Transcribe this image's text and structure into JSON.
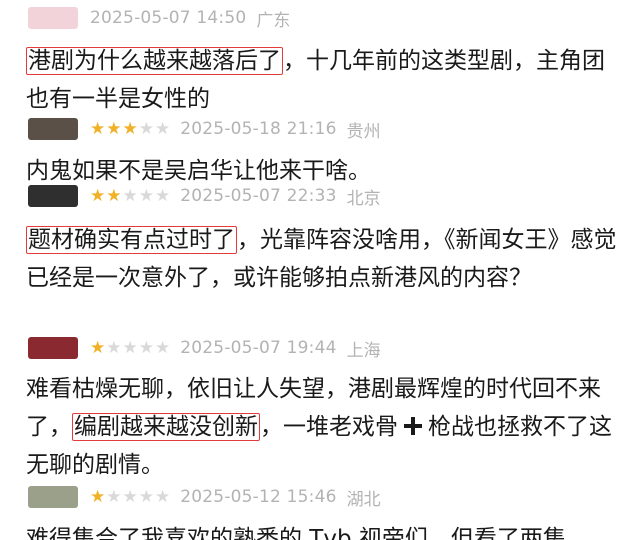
{
  "comments": [
    {
      "timestamp": "2025-05-07 14:50",
      "location": "广东",
      "rating": 0,
      "avatar_color": "#f2d3da",
      "text_before": "",
      "highlight": "港剧为什么越来越落后了",
      "text_after": "，十几年前的这类型剧，主角团也有一半是女性的"
    },
    {
      "timestamp": "2025-05-18 21:16",
      "location": "贵州",
      "rating": 3,
      "avatar_color": "#5b5048",
      "text": "内鬼如果不是吴启华让他来干啥。"
    },
    {
      "timestamp": "2025-05-07 22:33",
      "location": "北京",
      "rating": 2,
      "avatar_color": "#2f2f2f",
      "text_before": "",
      "highlight": "题材确实有点过时了",
      "text_after": "，光靠阵容没啥用，《新闻女王》感觉已经是一次意外了，或许能够拍点新港风的内容？"
    },
    {
      "timestamp": "2025-05-07 19:44",
      "location": "上海",
      "rating": 1,
      "avatar_color": "#8a2a30",
      "text_before": "难看枯燥无聊，依旧让人失望，港剧最辉煌的时代回不来了，",
      "highlight": "编剧越来越没创新",
      "text_mid": "，一堆老戏骨",
      "text_after": "枪战也拯救不了这无聊的剧情。"
    },
    {
      "timestamp": "2025-05-12 15:46",
      "location": "湖北",
      "rating": 1,
      "avatar_color": "#9aa08a",
      "text": "难得集合了我喜欢的熟悉的 Tvb 视帝们，但看了两集"
    }
  ],
  "max_rating": 5
}
